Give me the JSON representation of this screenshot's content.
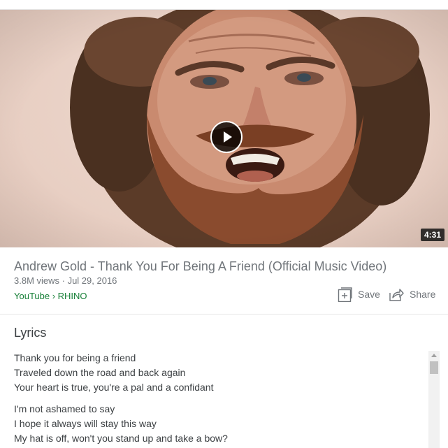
{
  "video": {
    "duration": "4:31",
    "play_icon": "play-icon"
  },
  "result": {
    "title": "Andrew Gold - Thank You For Being A Friend (Official Music Video)",
    "meta": "3.8M views · Jul 29, 2016",
    "source": "YouTube › RHINO"
  },
  "actions": {
    "save_label": "Save",
    "save_icon": "add-to-playlist-icon",
    "share_label": "Share",
    "share_icon": "share-icon"
  },
  "lyrics": {
    "heading": "Lyrics",
    "stanzas": [
      [
        "Thank you for being a friend",
        "Traveled down the road and back again",
        "Your heart is true, you're a pal and a confidant"
      ],
      [
        "I'm not ashamed to say",
        "I hope it always will stay this way",
        "My hat is off, won't you stand up and take a bow?"
      ]
    ]
  },
  "colors": {
    "source_green": "#188038",
    "meta_gray": "#70757a",
    "text_dark": "#3c4043"
  }
}
